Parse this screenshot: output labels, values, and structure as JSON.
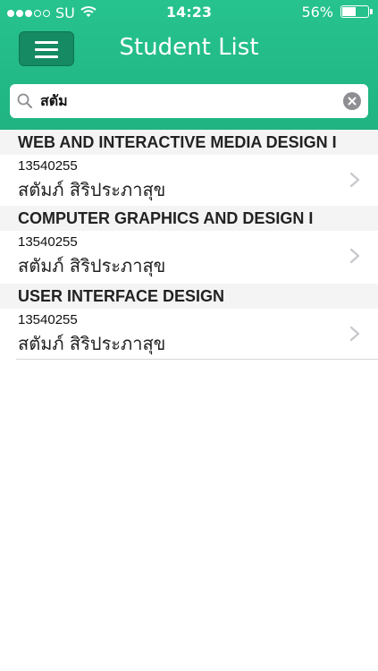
{
  "status_bar": {
    "carrier": "SU",
    "time": "14:23",
    "battery_percent_label": "56%",
    "battery_level": 0.56
  },
  "nav": {
    "title": "Student List"
  },
  "search": {
    "value": "สตัม"
  },
  "sections": [
    {
      "title": "WEB AND INTERACTIVE MEDIA DESIGN I",
      "rows": [
        {
          "id": "13540255",
          "name": "สตัมภ์ สิริประภาสุข"
        }
      ]
    },
    {
      "title": "COMPUTER GRAPHICS AND DESIGN I",
      "rows": [
        {
          "id": "13540255",
          "name": "สตัมภ์ สิริประภาสุข"
        }
      ]
    },
    {
      "title": "USER INTERFACE DESIGN",
      "rows": [
        {
          "id": "13540255",
          "name": "สตัมภ์ สิริประภาสุข"
        }
      ]
    }
  ],
  "colors": {
    "header_green": "#22bb88",
    "menu_button": "#168a62"
  },
  "icons": [
    "signal-dots-icon",
    "wifi-icon",
    "battery-icon",
    "menu-icon",
    "search-icon",
    "clear-icon",
    "chevron-right-icon"
  ]
}
